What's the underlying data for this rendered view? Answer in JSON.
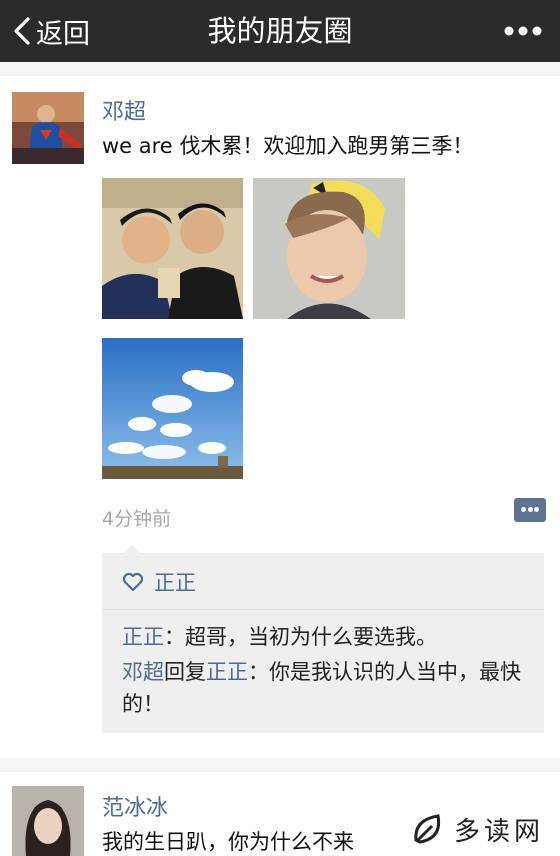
{
  "nav": {
    "back_label": "返回",
    "title": "我的朋友圈",
    "more_icon": "more-dots-icon"
  },
  "posts": [
    {
      "name": "邓超",
      "content": "we are 伐木累！欢迎加入跑男第三季！",
      "photos": [
        "two-men-photo",
        "young-man-cap-photo",
        "blue-sky-clouds-photo"
      ],
      "time": "4分钟前",
      "likes": {
        "name": "正正"
      },
      "comments": [
        {
          "author": "正正",
          "sep": "：",
          "text": "超哥，当初为什么要选我。"
        },
        {
          "author": "邓超",
          "reply_word": "回复",
          "target": "正正",
          "sep": "：",
          "text": "你是我认识的人当中，最快的！"
        }
      ]
    },
    {
      "name": "范冰冰",
      "content": "我的生日趴，你为什么不来"
    }
  ],
  "watermark": {
    "text": "多读网"
  }
}
